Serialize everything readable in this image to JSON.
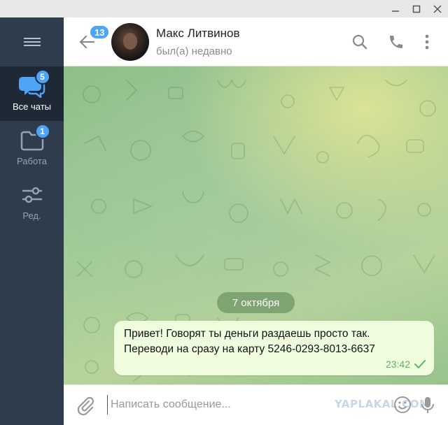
{
  "window": {
    "minimize_label": "—",
    "maximize_label": "☐",
    "close_label": "✕"
  },
  "sidebar": {
    "menu_icon": "hamburger-icon",
    "folders": [
      {
        "label": "Все чаты",
        "badge": "5",
        "icon": "chats-icon",
        "active": true
      },
      {
        "label": "Работа",
        "badge": "1",
        "icon": "folder-icon",
        "active": false
      },
      {
        "label": "Ред.",
        "badge": "",
        "icon": "sliders-icon",
        "active": false
      }
    ]
  },
  "header": {
    "back_badge": "13",
    "contact_name": "Макс Литвинов",
    "contact_status": "был(а) недавно"
  },
  "chat": {
    "date_separator": "7 октября",
    "messages": [
      {
        "text_line1": "Привет! Говорят ты деньги раздаешь просто так.",
        "text_line2": "Переводи на сразу на карту 5246-0293-8013-6637",
        "time": "23:42",
        "status_icon": "check-icon"
      }
    ]
  },
  "composer": {
    "placeholder": "Написать сообщение...",
    "value": ""
  },
  "watermark": "YAPLAKAL.COM",
  "colors": {
    "sidebar_bg": "#2e3c4d",
    "sidebar_active_bg": "#1f2936",
    "badge": "#4ea4f6",
    "bubble_out": "#effdde",
    "read_check": "#5fb35f"
  }
}
